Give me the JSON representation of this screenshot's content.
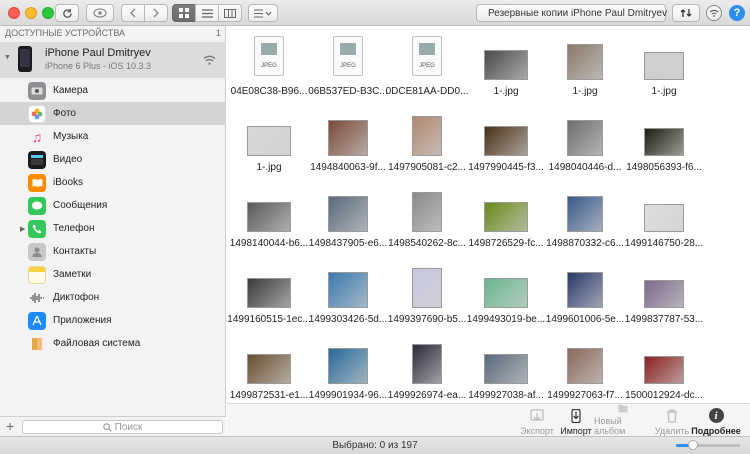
{
  "toolbar": {
    "backup_label": "Резервные копии iPhone Paul Dmitryev",
    "help_label": "?"
  },
  "sidebar": {
    "section_title": "ДОСТУПНЫЕ УСТРОЙСТВА",
    "section_count": "1",
    "device": {
      "name": "iPhone Paul Dmitryev",
      "subtitle": "iPhone 6 Plus - iOS 10.3.3"
    },
    "items": [
      {
        "label": "Камера",
        "icon": "camera-icon",
        "color": "#8e8e93"
      },
      {
        "label": "Фото",
        "icon": "photos-icon",
        "color": "#f4b400"
      },
      {
        "label": "Музыка",
        "icon": "music-icon",
        "color": "#fc3c6e"
      },
      {
        "label": "Видео",
        "icon": "video-icon",
        "color": "#1c1c1e"
      },
      {
        "label": "iBooks",
        "icon": "ibooks-icon",
        "color": "#ff8c00"
      },
      {
        "label": "Сообщения",
        "icon": "messages-icon",
        "color": "#34c759"
      },
      {
        "label": "Телефон",
        "icon": "phone-icon",
        "color": "#34c759"
      },
      {
        "label": "Контакты",
        "icon": "contacts-icon",
        "color": "#9e9e9e"
      },
      {
        "label": "Заметки",
        "icon": "notes-icon",
        "color": "#f7d341"
      },
      {
        "label": "Диктофон",
        "icon": "voice-memos-icon",
        "color": "#3a3a3c"
      },
      {
        "label": "Приложения",
        "icon": "app-store-icon",
        "color": "#1a8cff"
      },
      {
        "label": "Файловая система",
        "icon": "folder-icon",
        "color": "#f0b456"
      }
    ],
    "search_placeholder": "Поиск",
    "add_label": "+"
  },
  "files": [
    {
      "name": "04E08C38-B96...",
      "kind": "jpeg"
    },
    {
      "name": "06B537ED-B3C...",
      "kind": "jpeg"
    },
    {
      "name": "0DCE81AA-DD0...",
      "kind": "jpeg"
    },
    {
      "name": "1-.jpg",
      "kind": "photo",
      "color": "#4a4a4a"
    },
    {
      "name": "1-.jpg",
      "kind": "photo",
      "color": "#8a7a6a"
    },
    {
      "name": "1-.jpg",
      "kind": "photo",
      "color": "#cfcfcf"
    },
    {
      "name": "1-.jpg",
      "kind": "photo",
      "color": "#d8d8d8"
    },
    {
      "name": "1494840063-9f...",
      "kind": "photo",
      "color": "#7a4a3a"
    },
    {
      "name": "1497905081-c2...",
      "kind": "photo",
      "color": "#b08870"
    },
    {
      "name": "1497990445-f3...",
      "kind": "photo",
      "color": "#4a3018"
    },
    {
      "name": "1498040446-d...",
      "kind": "photo",
      "color": "#6e6e6e"
    },
    {
      "name": "1498056393-f6...",
      "kind": "photo",
      "color": "#1e1e10"
    },
    {
      "name": "1498140044-b6...",
      "kind": "photo",
      "color": "#5a5a5a"
    },
    {
      "name": "1498437905-e6...",
      "kind": "photo",
      "color": "#5a6a7a"
    },
    {
      "name": "1498540262-8c...",
      "kind": "photo",
      "color": "#8a8a8a"
    },
    {
      "name": "1498726529-fc...",
      "kind": "photo",
      "color": "#6a8a1a"
    },
    {
      "name": "1498870332-c6...",
      "kind": "photo",
      "color": "#3a5a8a"
    },
    {
      "name": "1499146750-28...",
      "kind": "photo",
      "color": "#dedede"
    },
    {
      "name": "1499160515-1ec...",
      "kind": "photo",
      "color": "#3a3a3a"
    },
    {
      "name": "1499303426-5d...",
      "kind": "photo",
      "color": "#3a7ab0"
    },
    {
      "name": "1499397690-b5...",
      "kind": "photo",
      "color": "#c8c8e0"
    },
    {
      "name": "1499493019-be...",
      "kind": "photo",
      "color": "#6ab890"
    },
    {
      "name": "1499601006-5e...",
      "kind": "photo",
      "color": "#2a3a6a"
    },
    {
      "name": "1499837787-53...",
      "kind": "photo",
      "color": "#7a6a8a"
    },
    {
      "name": "1499872531-e1...",
      "kind": "photo",
      "color": "#6a5030"
    },
    {
      "name": "1499901934-96...",
      "kind": "photo",
      "color": "#2a6a9a"
    },
    {
      "name": "1499926974-ea...",
      "kind": "photo",
      "color": "#2a2a3a"
    },
    {
      "name": "1499927038-af...",
      "kind": "photo",
      "color": "#5a6a7a"
    },
    {
      "name": "1499927063-f7...",
      "kind": "photo",
      "color": "#8a6a5a"
    },
    {
      "name": "1500012924-dc...",
      "kind": "photo",
      "color": "#8a2020"
    }
  ],
  "actions": [
    {
      "label": "Экспорт",
      "icon": "export-icon",
      "enabled": false
    },
    {
      "label": "Импорт",
      "icon": "import-icon",
      "enabled": true
    },
    {
      "label": "Новый альбом",
      "icon": "new-album-icon",
      "enabled": false
    },
    {
      "label": "Удалить",
      "icon": "trash-icon",
      "enabled": false
    },
    {
      "label": "Подробнее",
      "icon": "info-icon",
      "enabled": true
    }
  ],
  "status": {
    "text": "Выбрано: 0 из 197"
  }
}
